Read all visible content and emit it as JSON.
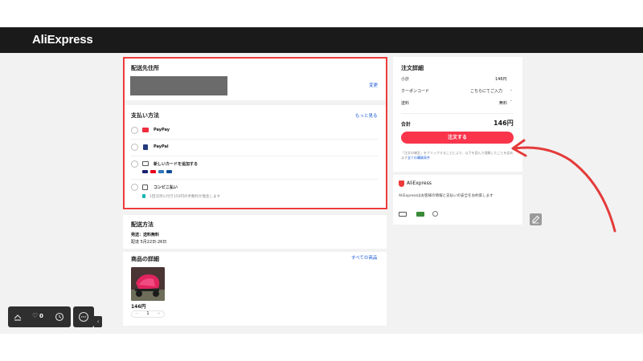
{
  "header": {
    "logo": "AliExpress"
  },
  "address": {
    "title": "配送先住所",
    "change_label": "変更"
  },
  "payment": {
    "title": "支払い方法",
    "more_label": "もっと見る",
    "methods": [
      {
        "label": "PayPay"
      },
      {
        "label": "PayPal"
      },
      {
        "label": "新しいカードを追加する"
      },
      {
        "label": "コンビニ払い",
        "note": "1回決済に付き150円の手数料が発生します"
      }
    ]
  },
  "shipping": {
    "title": "配送方法",
    "line1": "発送：送料無料",
    "line2": "配達 5月22日-26日"
  },
  "products": {
    "title": "商品の詳細",
    "all_label": "すべての商品",
    "item_price": "146円",
    "quantity": "1",
    "qty_minus": "−",
    "qty_plus": "+"
  },
  "summary": {
    "title": "注文詳細",
    "subtotal_label": "小計",
    "subtotal_value": "146円",
    "coupon_label": "クーポンコード",
    "coupon_value": "こちらにてご入力",
    "shipping_label": "送料",
    "shipping_value": "無料",
    "total_label": "合計",
    "total_value": "146円",
    "order_button": "注文する",
    "terms_prefix": "「注文の確定」をクリックすることにより、以下を読んで理解したことを認めます",
    "terms_link": "全ての購買条件"
  },
  "trust": {
    "logo": "AliExpress",
    "text": "AliExpressはお客様の情報と支払いの安全をお約束します"
  },
  "floating": {
    "wishlist_count": "0"
  },
  "colors": {
    "accent": "#f9344b",
    "highlight": "#ee3b3b",
    "link": "#1757d8",
    "topbar": "#1a1a1a"
  }
}
